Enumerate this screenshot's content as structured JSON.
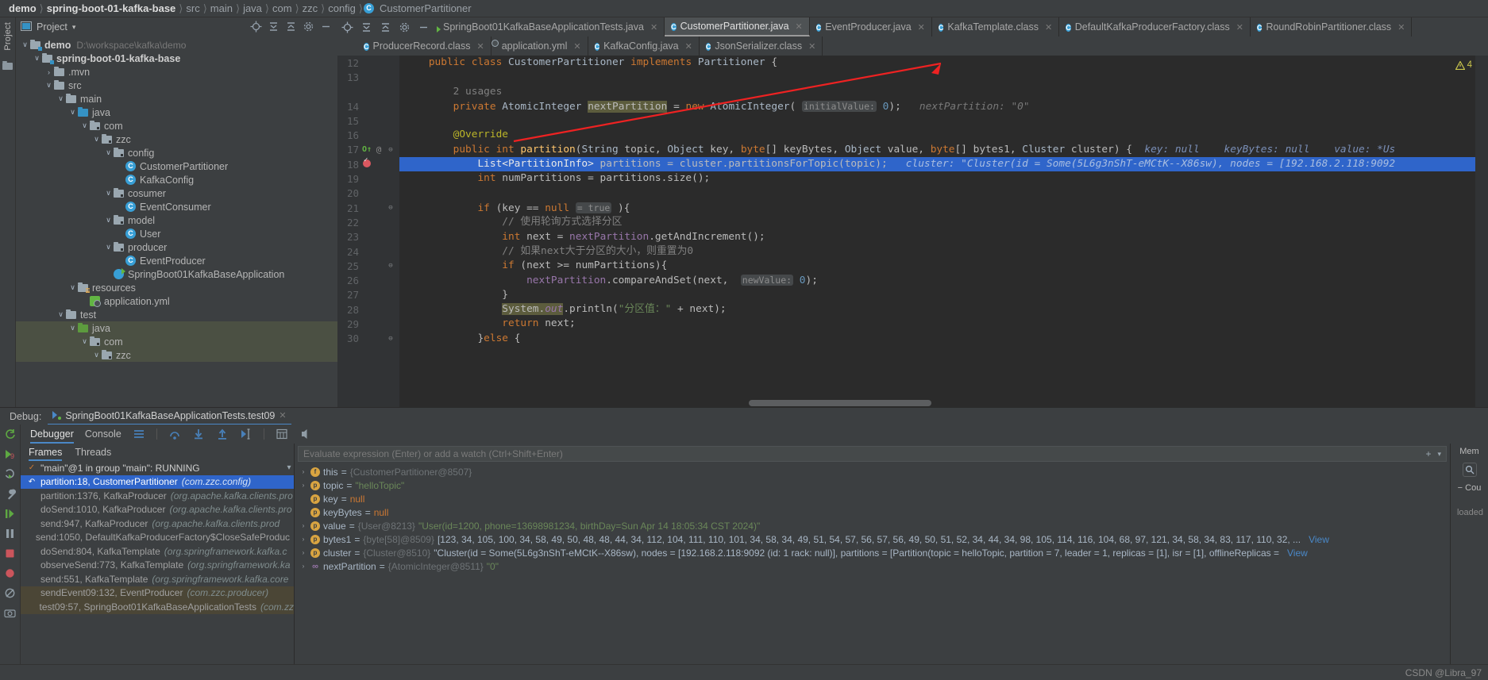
{
  "breadcrumb": {
    "items": [
      {
        "label": "demo",
        "bold": true
      },
      {
        "label": "spring-boot-01-kafka-base",
        "bold": true
      },
      {
        "label": "src",
        "bold": false
      },
      {
        "label": "main",
        "bold": false
      },
      {
        "label": "java",
        "bold": false
      },
      {
        "label": "com",
        "bold": false
      },
      {
        "label": "zzc",
        "bold": false
      },
      {
        "label": "config",
        "bold": false
      }
    ],
    "current_file": "CustomerPartitioner",
    "separator": "〉"
  },
  "project_panel": {
    "vertical_label": "Project",
    "title": "Project",
    "dropdown": "▾",
    "tree": [
      {
        "depth": 0,
        "arrow": "∨",
        "icon": "module-folder",
        "label": "demo",
        "bold": true,
        "sub": "D:\\workspace\\kafka\\demo"
      },
      {
        "depth": 1,
        "arrow": "∨",
        "icon": "module-folder",
        "label": "spring-boot-01-kafka-base",
        "bold": true,
        "sub": ""
      },
      {
        "depth": 2,
        "arrow": "›",
        "icon": "folder",
        "label": ".mvn",
        "bold": false,
        "sub": ""
      },
      {
        "depth": 2,
        "arrow": "∨",
        "icon": "folder",
        "label": "src",
        "bold": false,
        "sub": ""
      },
      {
        "depth": 3,
        "arrow": "∨",
        "icon": "folder",
        "label": "main",
        "bold": false,
        "sub": ""
      },
      {
        "depth": 4,
        "arrow": "∨",
        "icon": "source-folder",
        "label": "java",
        "bold": false,
        "sub": ""
      },
      {
        "depth": 5,
        "arrow": "∨",
        "icon": "package",
        "label": "com",
        "bold": false,
        "sub": ""
      },
      {
        "depth": 6,
        "arrow": "∨",
        "icon": "package",
        "label": "zzc",
        "bold": false,
        "sub": ""
      },
      {
        "depth": 7,
        "arrow": "∨",
        "icon": "package",
        "label": "config",
        "bold": false,
        "sub": ""
      },
      {
        "depth": 8,
        "arrow": "",
        "icon": "class",
        "label": "CustomerPartitioner",
        "bold": false,
        "sub": ""
      },
      {
        "depth": 8,
        "arrow": "",
        "icon": "class",
        "label": "KafkaConfig",
        "bold": false,
        "sub": ""
      },
      {
        "depth": 7,
        "arrow": "∨",
        "icon": "package",
        "label": "cosumer",
        "bold": false,
        "sub": ""
      },
      {
        "depth": 8,
        "arrow": "",
        "icon": "class",
        "label": "EventConsumer",
        "bold": false,
        "sub": ""
      },
      {
        "depth": 7,
        "arrow": "∨",
        "icon": "package",
        "label": "model",
        "bold": false,
        "sub": ""
      },
      {
        "depth": 8,
        "arrow": "",
        "icon": "class",
        "label": "User",
        "bold": false,
        "sub": ""
      },
      {
        "depth": 7,
        "arrow": "∨",
        "icon": "package",
        "label": "producer",
        "bold": false,
        "sub": ""
      },
      {
        "depth": 8,
        "arrow": "",
        "icon": "class",
        "label": "EventProducer",
        "bold": false,
        "sub": ""
      },
      {
        "depth": 7,
        "arrow": "",
        "icon": "spring-class",
        "label": "SpringBoot01KafkaBaseApplication",
        "bold": false,
        "sub": ""
      },
      {
        "depth": 4,
        "arrow": "∨",
        "icon": "resources-folder",
        "label": "resources",
        "bold": false,
        "sub": ""
      },
      {
        "depth": 5,
        "arrow": "",
        "icon": "yml",
        "label": "application.yml",
        "bold": false,
        "sub": ""
      },
      {
        "depth": 3,
        "arrow": "∨",
        "icon": "folder",
        "label": "test",
        "bold": false,
        "sub": ""
      },
      {
        "depth": 4,
        "arrow": "∨",
        "icon": "test-source-folder",
        "label": "java",
        "bold": false,
        "sub": "",
        "selected": true
      },
      {
        "depth": 5,
        "arrow": "∨",
        "icon": "package",
        "label": "com",
        "bold": false,
        "sub": "",
        "selected": true
      },
      {
        "depth": 6,
        "arrow": "∨",
        "icon": "package",
        "label": "zzc",
        "bold": false,
        "sub": "",
        "selected": true
      }
    ]
  },
  "editor": {
    "toolbar_icons": [
      "locate-icon",
      "collapse-all-icon",
      "expand-icon",
      "settings-gear-icon",
      "hide-icon"
    ],
    "tabs_row1": [
      {
        "label": "SpringBoot01KafkaBaseApplicationTests.java",
        "icon": "spring-test-class-icon",
        "active": false
      },
      {
        "label": "CustomerPartitioner.java",
        "icon": "java-class-icon",
        "active": true
      },
      {
        "label": "EventProducer.java",
        "icon": "java-class-icon",
        "active": false
      },
      {
        "label": "KafkaTemplate.class",
        "icon": "java-class-icon",
        "active": false
      },
      {
        "label": "DefaultKafkaProducerFactory.class",
        "icon": "java-class-icon",
        "active": false
      },
      {
        "label": "RoundRobinPartitioner.class",
        "icon": "java-class-icon",
        "active": false
      }
    ],
    "tabs_row2": [
      {
        "label": "ProducerRecord.class",
        "icon": "java-class-icon",
        "active": false
      },
      {
        "label": "application.yml",
        "icon": "yml-icon",
        "active": false
      },
      {
        "label": "KafkaConfig.java",
        "icon": "java-class-icon",
        "active": false
      },
      {
        "label": "JsonSerializer.class",
        "icon": "java-class-icon",
        "active": false
      }
    ],
    "warning_count": "4",
    "lines": [
      {
        "num": "12",
        "gutter_ann": "",
        "fold": "",
        "breakpoint": false,
        "override": false,
        "html": "    <span class=\"k\">public class</span> <span class=\"t\">CustomerPartitioner</span> <span class=\"k\">implements</span> <span class=\"t\">Partitioner</span> {"
      },
      {
        "num": "13",
        "gutter_ann": "",
        "fold": "",
        "breakpoint": false,
        "override": false,
        "html": ""
      },
      {
        "num": "",
        "gutter_ann": "",
        "fold": "",
        "breakpoint": false,
        "override": false,
        "html": "        <span class=\"c\">2 usages</span>"
      },
      {
        "num": "14",
        "gutter_ann": "",
        "fold": "",
        "breakpoint": false,
        "override": false,
        "html": "        <span class=\"k\">private</span> <span class=\"t\">AtomicInteger</span> <span class=\"nphl\">nextPartition</span> = <span class=\"k\">new</span> <span class=\"t\">AtomicInteger</span>( <span class=\"paramhint\">initialValue:</span> <span class=\"n\">0</span>);   <span class=\"hint\">nextPartition: \"0\"</span>"
      },
      {
        "num": "15",
        "gutter_ann": "",
        "fold": "",
        "breakpoint": false,
        "override": false,
        "html": ""
      },
      {
        "num": "16",
        "gutter_ann": "",
        "fold": "",
        "breakpoint": false,
        "override": false,
        "html": "        <span class=\"an\">@Override</span>"
      },
      {
        "num": "17",
        "gutter_ann": "@",
        "fold": "⊖",
        "breakpoint": false,
        "override": true,
        "html": "        <span class=\"k\">public int</span> <span class=\"f\">partition</span>(<span class=\"t\">String</span> topic, <span class=\"t\">Object</span> key, <span class=\"k\">byte</span>[] keyBytes, <span class=\"t\">Object</span> value, <span class=\"k\">byte</span>[] bytes1, <span class=\"t\">Cluster</span> cluster) {  <span class=\"dbghint\">key: null    keyBytes: null    value: *Us</span>"
      },
      {
        "num": "18",
        "gutter_ann": "",
        "fold": "",
        "breakpoint": true,
        "override": false,
        "highlight": true,
        "html": "            <span class=\"t\">List&lt;PartitionInfo&gt;</span> partitions = cluster.partitionsForTopic(topic);   <span class=\"dbghint\">cluster: \"Cluster(id = Some(5L6g3nShT-eMCtK--X86sw), nodes = [192.168.2.118:9092</span>"
      },
      {
        "num": "19",
        "gutter_ann": "",
        "fold": "",
        "breakpoint": false,
        "override": false,
        "html": "            <span class=\"k\">int</span> numPartitions = partitions.size();"
      },
      {
        "num": "20",
        "gutter_ann": "",
        "fold": "",
        "breakpoint": false,
        "override": false,
        "html": ""
      },
      {
        "num": "21",
        "gutter_ann": "",
        "fold": "⊖",
        "breakpoint": false,
        "override": false,
        "html": "            <span class=\"k\">if</span> (key == <span class=\"k\">null</span> <span class=\"paramhint\">= true</span> ){"
      },
      {
        "num": "22",
        "gutter_ann": "",
        "fold": "",
        "breakpoint": false,
        "override": false,
        "html": "                <span class=\"c\">// 使用轮询方式选择分区</span>"
      },
      {
        "num": "23",
        "gutter_ann": "",
        "fold": "",
        "breakpoint": false,
        "override": false,
        "html": "                <span class=\"k\">int</span> next = <span class=\"fld\">nextPartition</span>.getAndIncrement();"
      },
      {
        "num": "24",
        "gutter_ann": "",
        "fold": "",
        "breakpoint": false,
        "override": false,
        "html": "                <span class=\"c\">// 如果next大于分区的大小，则重置为0</span>"
      },
      {
        "num": "25",
        "gutter_ann": "",
        "fold": "⊖",
        "breakpoint": false,
        "override": false,
        "html": "                <span class=\"k\">if</span> (next &gt;= numPartitions){"
      },
      {
        "num": "26",
        "gutter_ann": "",
        "fold": "",
        "breakpoint": false,
        "override": false,
        "html": "                    <span class=\"fld\">nextPartition</span>.compareAndSet(next,  <span class=\"paramhint\">newValue:</span> <span class=\"n\">0</span>);"
      },
      {
        "num": "27",
        "gutter_ann": "",
        "fold": "",
        "breakpoint": false,
        "override": false,
        "html": "                }"
      },
      {
        "num": "28",
        "gutter_ann": "",
        "fold": "",
        "breakpoint": false,
        "override": false,
        "html": "                <span class=\"nphl\">System.<span class=\"fld\" style=\"font-style:italic\">out</span></span>.println(<span class=\"s\">\"分区值：\"</span> + next);"
      },
      {
        "num": "29",
        "gutter_ann": "",
        "fold": "",
        "breakpoint": false,
        "override": false,
        "html": "                <span class=\"k\">return</span> next;"
      },
      {
        "num": "30",
        "gutter_ann": "",
        "fold": "⊖",
        "breakpoint": false,
        "override": false,
        "html": "            }<span class=\"k\">else</span> {"
      }
    ]
  },
  "debug": {
    "label": "Debug:",
    "session_tab": "SpringBoot01KafkaBaseApplicationTests.test09",
    "tabs": [
      {
        "label": "Debugger",
        "selected": true
      },
      {
        "label": "Console",
        "selected": false
      }
    ],
    "toolbar_icons": [
      "layout-icon",
      "step-over-icon",
      "step-into-icon",
      "step-out-icon",
      "run-to-cursor-icon",
      "evaluate-icon",
      "mute-icon"
    ],
    "side_icons": [
      "rerun-icon",
      "resume-icon-9",
      "restart-icon",
      "settings-wrench-icon",
      "resume-program-icon",
      "pause-icon",
      "stop-icon",
      "view-breakpoints-icon",
      "mute-breakpoints-icon",
      "camera-icon"
    ],
    "frames_tabs": [
      {
        "label": "Frames",
        "selected": true
      },
      {
        "label": "Threads",
        "selected": false
      }
    ],
    "thread_line": "\"main\"@1 in group \"main\": RUNNING",
    "frames": [
      {
        "text": "partition:18, CustomerPartitioner",
        "pkg": "(com.zzc.config)",
        "selected": true,
        "gold": false
      },
      {
        "text": "partition:1376, KafkaProducer",
        "pkg": "(org.apache.kafka.clients.pro",
        "selected": false,
        "gold": false
      },
      {
        "text": "doSend:1010, KafkaProducer",
        "pkg": "(org.apache.kafka.clients.pro",
        "selected": false,
        "gold": false
      },
      {
        "text": "send:947, KafkaProducer",
        "pkg": "(org.apache.kafka.clients.prod",
        "selected": false,
        "gold": false
      },
      {
        "text": "send:1050, DefaultKafkaProducerFactory$CloseSafeProduc",
        "pkg": "",
        "selected": false,
        "gold": false
      },
      {
        "text": "doSend:804, KafkaTemplate",
        "pkg": "(org.springframework.kafka.c",
        "selected": false,
        "gold": false
      },
      {
        "text": "observeSend:773, KafkaTemplate",
        "pkg": "(org.springframework.ka",
        "selected": false,
        "gold": false
      },
      {
        "text": "send:551, KafkaTemplate",
        "pkg": "(org.springframework.kafka.core",
        "selected": false,
        "gold": false
      },
      {
        "text": "sendEvent09:132, EventProducer",
        "pkg": "(com.zzc.producer)",
        "selected": false,
        "gold": true
      },
      {
        "text": "test09:57, SpringBoot01KafkaBaseApplicationTests",
        "pkg": "(com.zz",
        "selected": false,
        "gold": true
      }
    ],
    "evaluate_placeholder": "Evaluate expression (Enter) or add a watch (Ctrl+Shift+Enter)",
    "variables": [
      {
        "tri": "›",
        "icon": "this",
        "name": "this",
        "eq": "=",
        "type": "{CustomerPartitioner@8507}",
        "value": "",
        "value_class": "vval",
        "link": ""
      },
      {
        "tri": "›",
        "icon": "p",
        "name": "topic",
        "eq": "=",
        "type": "",
        "value": "\"helloTopic\"",
        "value_class": "vstr",
        "link": ""
      },
      {
        "tri": "",
        "icon": "p",
        "name": "key",
        "eq": "=",
        "type": "",
        "value": "null",
        "value_class": "vnull",
        "link": ""
      },
      {
        "tri": "",
        "icon": "p",
        "name": "keyBytes",
        "eq": "=",
        "type": "",
        "value": "null",
        "value_class": "vnull",
        "link": ""
      },
      {
        "tri": "›",
        "icon": "p",
        "name": "value",
        "eq": "=",
        "type": "{User@8213}",
        "value": "\"User(id=1200, phone=13698981234, birthDay=Sun Apr 14 18:05:34 CST 2024)\"",
        "value_class": "vstr",
        "link": ""
      },
      {
        "tri": "›",
        "icon": "p",
        "name": "bytes1",
        "eq": "=",
        "type": "{byte[58]@8509}",
        "value": "[123, 34, 105, 100, 34, 58, 49, 50, 48, 48, 44, 34, 112, 104, 111, 110, 101, 34, 58, 34, 49, 51, 54, 57, 56, 57, 56, 49, 50, 51, 52, 34, 44, 34, 98, 105, 114, 116, 104, 68, 97, 121, 34, 58, 34, 83, 117, 110, 32, ...",
        "value_class": "vval",
        "link": "View"
      },
      {
        "tri": "›",
        "icon": "p",
        "name": "cluster",
        "eq": "=",
        "type": "{Cluster@8510}",
        "value": "\"Cluster(id = Some(5L6g3nShT-eMCtK--X86sw), nodes = [192.168.2.118:9092 (id: 1 rack: null)], partitions = [Partition(topic = helloTopic, partition = 7, leader = 1, replicas = [1], isr = [1], offlineReplicas =",
        "value_class": "vval",
        "link": "View"
      },
      {
        "tri": "›",
        "icon": "oo",
        "name": "nextPartition",
        "eq": "=",
        "type": "{AtomicInteger@8511}",
        "value": "\"0\"",
        "value_class": "vstr",
        "link": ""
      }
    ],
    "right_panel": {
      "label": "Mem",
      "search_icon": "search-icon",
      "console_label": "Cou"
    },
    "loaded_text": "loaded"
  },
  "status_bar": {
    "watermark": "CSDN @Libra_97"
  }
}
